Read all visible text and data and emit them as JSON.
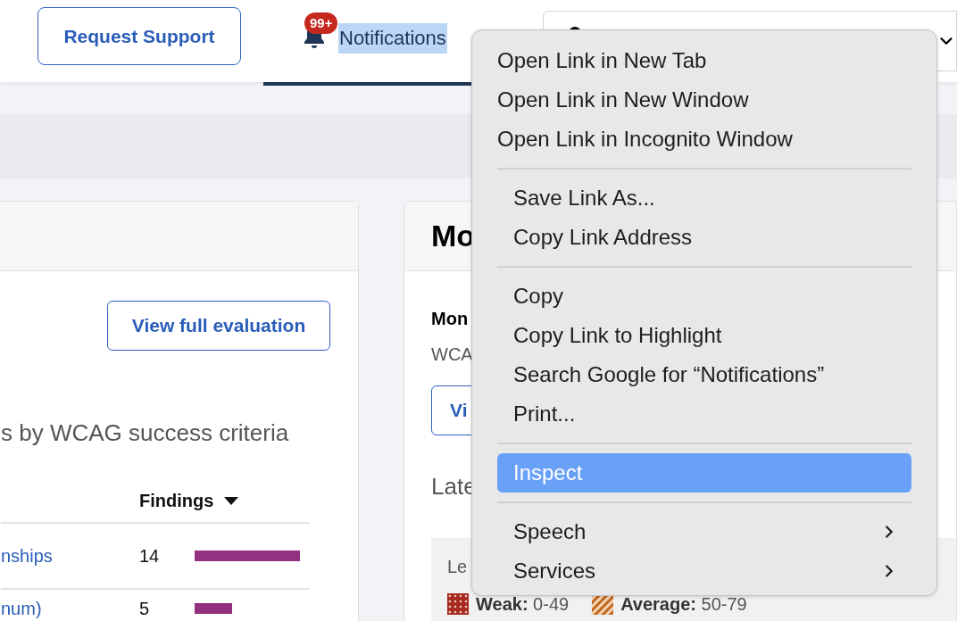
{
  "header": {
    "request_support_button": "Request Support",
    "notifications_tab": {
      "label": "Notifications",
      "badge": "99+",
      "selected": true,
      "text_highlighted": true
    }
  },
  "left_card": {
    "button": "View full evaluation",
    "subtitle": "s by WCAG success criteria",
    "table": {
      "columns": [
        {
          "label": "Findings",
          "sorted": true
        }
      ],
      "rows": [
        {
          "criterion": "nships",
          "findings": "14"
        },
        {
          "criterion": "num)",
          "findings": "5"
        }
      ]
    }
  },
  "right_card": {
    "title": "Mo",
    "label": "Mon",
    "sublabel": "WCA",
    "button": "Vi",
    "section_title": "Late",
    "legend": {
      "title": "Le",
      "items": [
        {
          "kind": "weak",
          "label": "Weak:",
          "range": "0-49"
        },
        {
          "kind": "average",
          "label": "Average:",
          "range": "50-79"
        }
      ]
    }
  },
  "context_menu": {
    "groups": [
      [
        {
          "label": "Open Link in New Tab",
          "selected": false,
          "submenu": false
        },
        {
          "label": "Open Link in New Window",
          "selected": false,
          "submenu": false
        },
        {
          "label": "Open Link in Incognito Window",
          "selected": false,
          "submenu": false
        }
      ],
      [
        {
          "label": "Save Link As...",
          "selected": false,
          "submenu": false
        },
        {
          "label": "Copy Link Address",
          "selected": false,
          "submenu": false
        }
      ],
      [
        {
          "label": "Copy",
          "selected": false,
          "submenu": false
        },
        {
          "label": "Copy Link to Highlight",
          "selected": false,
          "submenu": false
        },
        {
          "label": "Search Google for “Notifications”",
          "selected": false,
          "submenu": false
        },
        {
          "label": "Print...",
          "selected": false,
          "submenu": false
        }
      ],
      [
        {
          "label": "Inspect",
          "selected": true,
          "submenu": false
        }
      ],
      [
        {
          "label": "Speech",
          "selected": false,
          "submenu": true
        },
        {
          "label": "Services",
          "selected": false,
          "submenu": true
        }
      ]
    ]
  }
}
